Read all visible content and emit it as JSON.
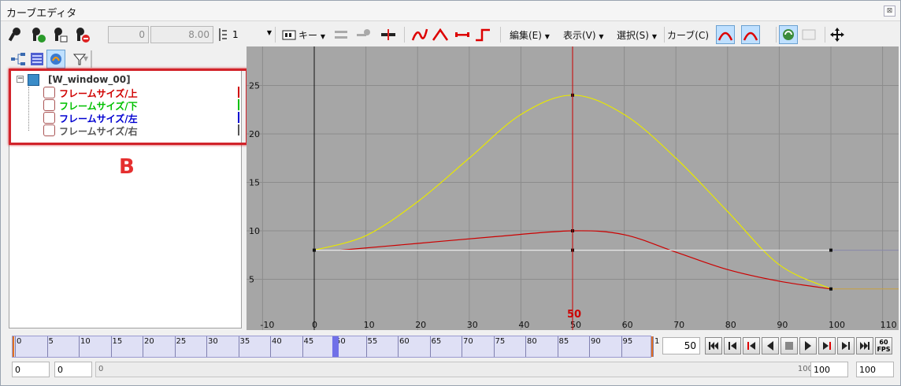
{
  "window": {
    "title": "カーブエディタ",
    "close_glyph": "⊠"
  },
  "toolbar": {
    "start_value": "0",
    "end_value": "8.00",
    "step_value": "1",
    "key_menu": "キー",
    "edit_menu": "編集(E)",
    "view_menu": "表示(V)",
    "select_menu": "選択(S)",
    "curve_menu": "カーブ(C)"
  },
  "tree": {
    "root_label": "[W_window_00]",
    "items": [
      {
        "label": "フレームサイズ/上",
        "color": "#d00000"
      },
      {
        "label": "フレームサイズ/下",
        "color": "#00c000"
      },
      {
        "label": "フレームサイズ/左",
        "color": "#0000d0"
      },
      {
        "label": "フレームサイズ/右",
        "color": "#555555"
      }
    ]
  },
  "annotation": {
    "label": "B"
  },
  "graph": {
    "y_ticks": [
      "25",
      "20",
      "15",
      "10",
      "5"
    ],
    "x_ticks": [
      "-10",
      "0",
      "10",
      "20",
      "30",
      "40",
      "50",
      "60",
      "70",
      "80",
      "90",
      "100",
      "110"
    ],
    "current_frame_label": "50",
    "colors": {
      "background": "#a6a6a6",
      "grid": "#8c8c8c",
      "playhead": "#cc0000",
      "curve_yellow": "#e8e800",
      "curve_red": "#cc0000",
      "curve_white": "#e8e8e8"
    }
  },
  "chart_data": {
    "type": "line",
    "title": "",
    "xlabel": "",
    "ylabel": "",
    "xlim": [
      -10,
      110
    ],
    "ylim": [
      0,
      26
    ],
    "series": [
      {
        "color": "#e8e800",
        "x": [
          0,
          10,
          20,
          30,
          40,
          50,
          60,
          70,
          80,
          90,
          100
        ],
        "y": [
          8,
          9.5,
          13,
          17.5,
          22,
          24,
          22,
          17.5,
          12,
          6.5,
          4
        ]
      },
      {
        "color": "#cc0000",
        "x": [
          5,
          20,
          35,
          50,
          60,
          70,
          80,
          90,
          100
        ],
        "y": [
          8,
          8.7,
          9.4,
          10,
          9.6,
          7.8,
          6,
          4.8,
          4
        ]
      },
      {
        "color": "#e8e8e8",
        "x": [
          0,
          50,
          100
        ],
        "y": [
          8,
          8,
          8
        ]
      }
    ]
  },
  "timeline": {
    "ticks": [
      "0",
      "5",
      "10",
      "15",
      "20",
      "25",
      "30",
      "35",
      "40",
      "45",
      "50",
      "55",
      "60",
      "65",
      "70",
      "75",
      "80",
      "85",
      "90",
      "95",
      "1"
    ],
    "current_frame": "50"
  },
  "transport": {
    "fps_label": "60 FPS"
  },
  "bottom": {
    "field_a": "0",
    "field_b": "0",
    "scroll_start": "0",
    "scroll_end": "100",
    "field_c": "100",
    "field_d": "100"
  }
}
